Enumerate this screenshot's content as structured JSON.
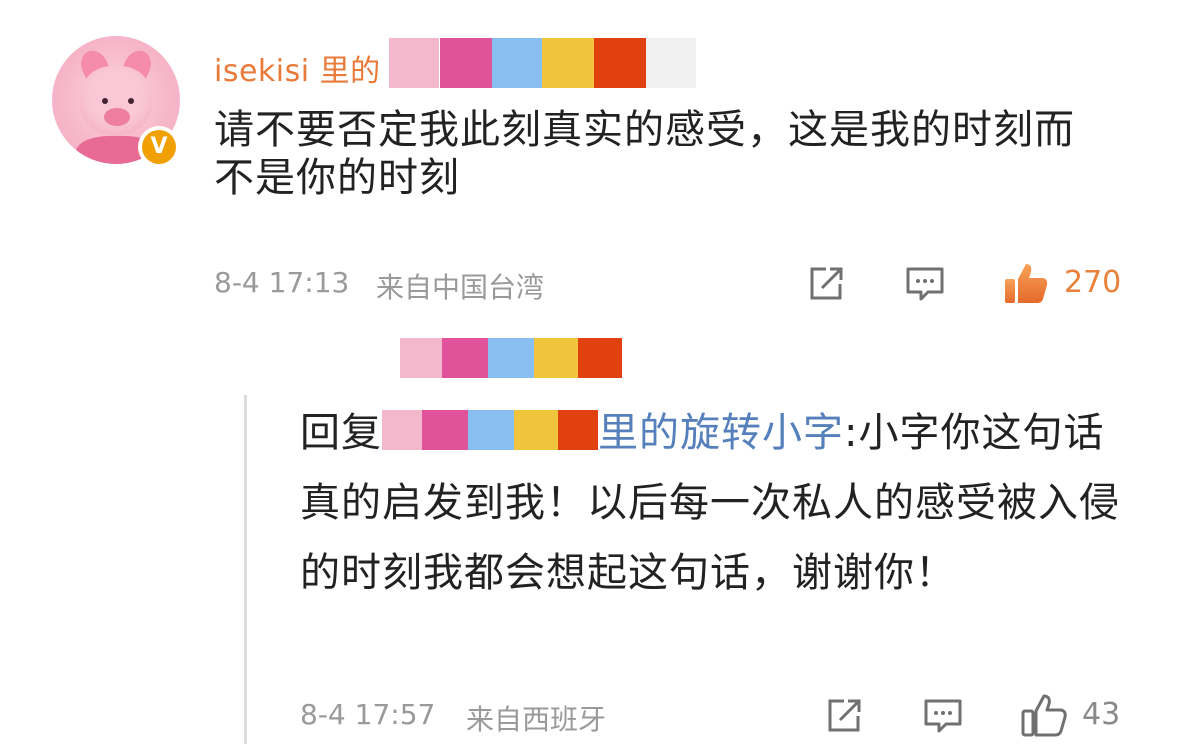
{
  "colors": {
    "accent_orange": "#e87a3a",
    "link_blue": "#5580bb",
    "text": "#222222",
    "meta_gray": "#9a9a9a",
    "like_orange": "#e8813a",
    "censor_blocks": [
      "#f3b8cb",
      "#e0529a",
      "#88bff0",
      "#f0c43c",
      "#e0410e",
      "#f0f0f0"
    ]
  },
  "comment": {
    "username": "isekisi 里的",
    "verified_badge": "V",
    "text": "请不要否定我此刻真实的感受，这是我的时刻而不是你的时刻",
    "timestamp": "8-4 17:13",
    "location": "来自中国台湾",
    "like_count": "270",
    "icons": [
      "share-icon",
      "comment-icon",
      "like-icon-filled"
    ]
  },
  "reply": {
    "prefix": "回复",
    "reply_to_name": "里的旋转小字",
    "text": ":小字你这句话真的启发到我！以后每一次私人的感受被入侵的时刻我都会想起这句话，谢谢你！",
    "timestamp": "8-4 17:57",
    "location": "来自西班牙",
    "like_count": "43",
    "icons": [
      "share-icon",
      "comment-icon",
      "like-icon"
    ]
  }
}
